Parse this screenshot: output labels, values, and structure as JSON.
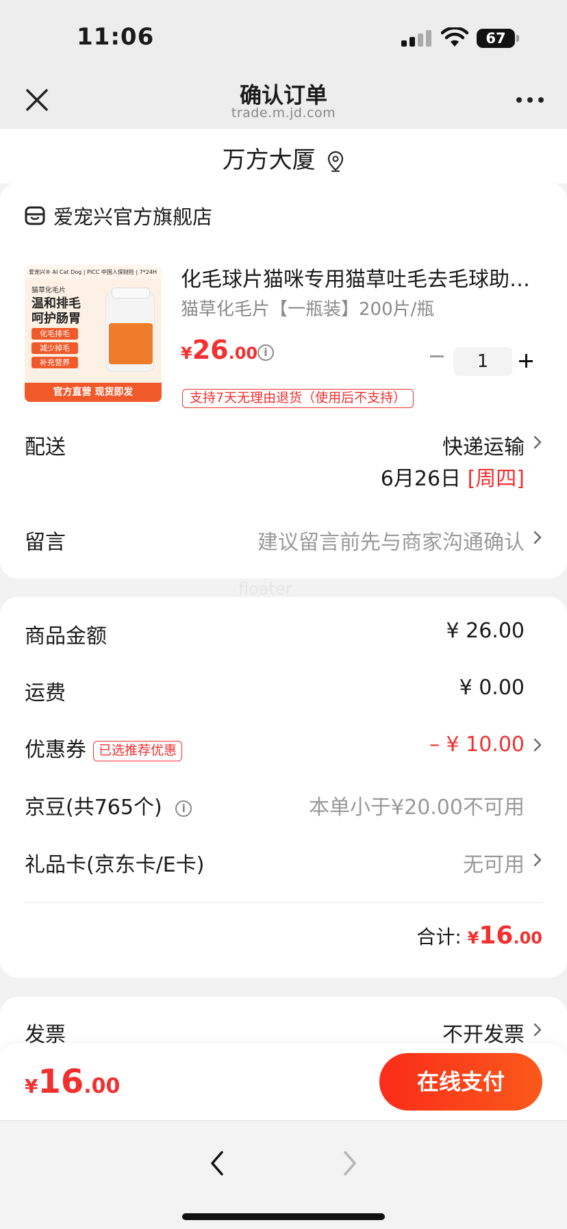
{
  "status_bar": {
    "time": "11:06",
    "battery": "67"
  },
  "nav": {
    "title": "确认订单",
    "subtitle": "trade.m.jd.com"
  },
  "address": {
    "text": "万方大厦"
  },
  "shop": {
    "name": "爱宠兴官方旗舰店"
  },
  "product": {
    "image_text": {
      "top": "爱宠兴® AI Cat Dog | PICC 中国人保财险 | 7*24H",
      "category": "猫草化毛片",
      "headline1": "温和排毛",
      "headline2": "呵护肠胃",
      "tags": [
        "化毛排毛",
        "减少掉毛",
        "补充营养"
      ],
      "bottom": "官方直营  现货即发"
    },
    "title": "化毛球片猫咪专用猫草吐毛去毛球助…",
    "spec": "猫草化毛片【一瓶装】200片/瓶",
    "price_currency": "¥",
    "price_int": "26",
    "price_dec": ".00",
    "quantity": "1",
    "return_policy": "支持7天无理由退货（使用后不支持）"
  },
  "delivery": {
    "label": "配送",
    "method": "快递运输",
    "date": "6月26日 ",
    "weekday": "[周四]"
  },
  "message": {
    "label": "留言",
    "placeholder": "建议留言前先与商家沟通确认"
  },
  "watermark": "floater",
  "summary": {
    "goods_label": "商品金额",
    "goods_value": "¥ 26.00",
    "shipping_label": "运费",
    "shipping_value": "¥ 0.00",
    "coupon_label": "优惠券",
    "coupon_badge": "已选推荐优惠",
    "coupon_value": "– ¥ 10.00",
    "beans_label": "京豆(共765个)",
    "beans_value": "本单小于¥20.00不可用",
    "giftcard_label": "礼品卡(京东卡/E卡)",
    "giftcard_value": "无可用",
    "total_label": "合计:",
    "total_currency": "¥",
    "total_int": "16",
    "total_dec": ".00"
  },
  "invoice": {
    "label": "发票",
    "value": "不开发票"
  },
  "pay_bar": {
    "currency": "¥",
    "int": "16",
    "dec": ".00",
    "button": "在线支付"
  },
  "colors": {
    "accent": "#f23030",
    "pay_button": "#fa2c19"
  }
}
